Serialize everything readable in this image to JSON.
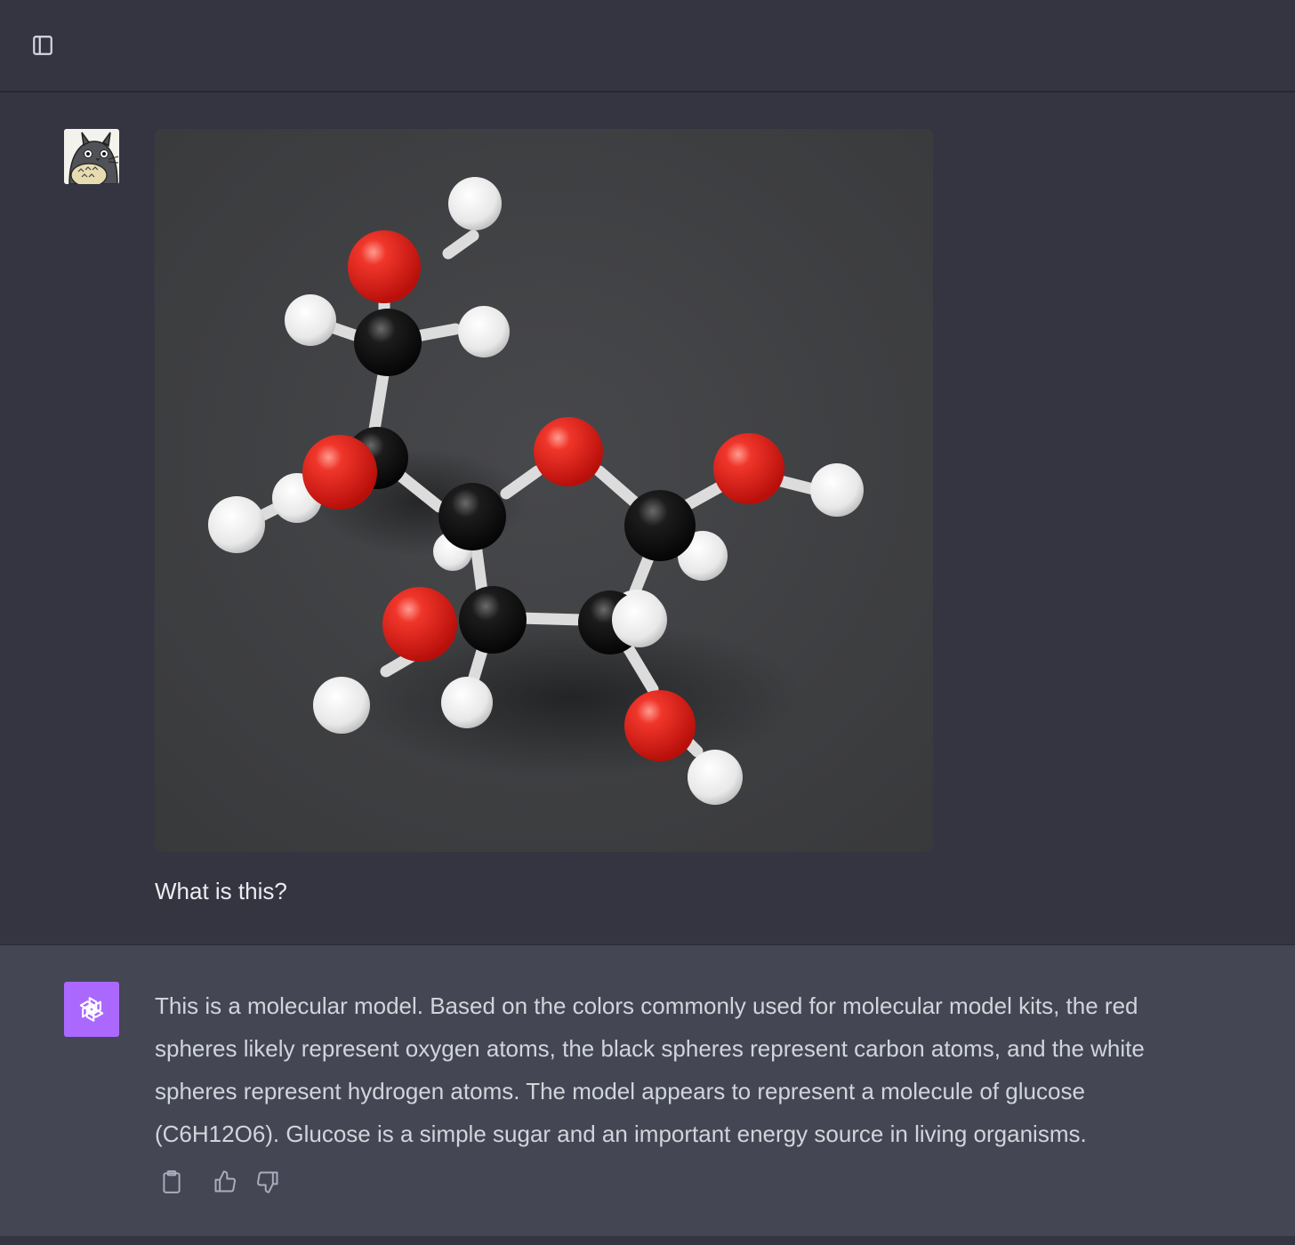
{
  "header": {
    "sidebar_toggle_icon": "sidebar-panel-icon"
  },
  "user_message": {
    "avatar_icon": "totoro-avatar-icon",
    "image_subject": "molecular-model-photo",
    "text": "What is this?"
  },
  "assistant_message": {
    "avatar_icon": "openai-logo-icon",
    "avatar_color": "#ab68ff",
    "text": "This is a molecular model. Based on the colors commonly used for molecular model kits, the red spheres likely represent oxygen atoms, the black spheres represent carbon atoms, and the white spheres represent hydrogen atoms. The model appears to represent a molecule of glucose (C6H12O6). Glucose is a simple sugar and an important energy source in living organisms.",
    "actions": {
      "copy_icon": "clipboard-icon",
      "like_icon": "thumbs-up-icon",
      "dislike_icon": "thumbs-down-icon"
    }
  },
  "colors": {
    "background": "#343541",
    "assistant_background": "#444654",
    "oxygen_red": "#e8261f",
    "carbon_black": "#111111",
    "hydrogen_white": "#f0f0f0"
  }
}
